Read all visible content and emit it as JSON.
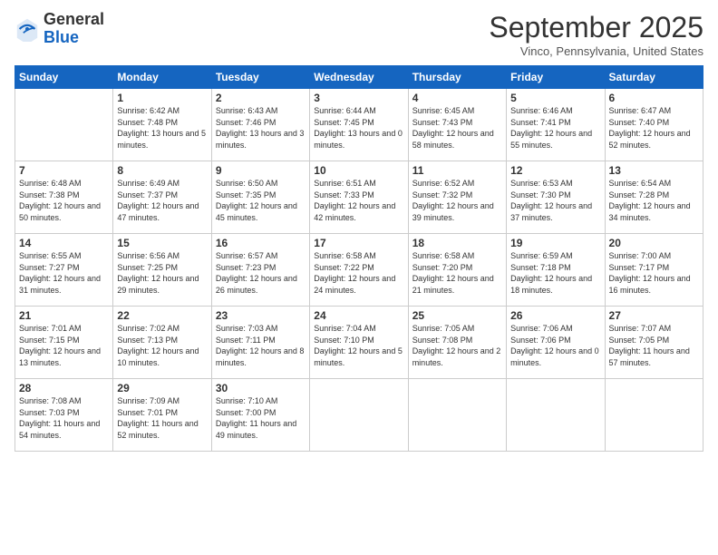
{
  "header": {
    "logo_general": "General",
    "logo_blue": "Blue",
    "month_title": "September 2025",
    "location": "Vinco, Pennsylvania, United States"
  },
  "days_of_week": [
    "Sunday",
    "Monday",
    "Tuesday",
    "Wednesday",
    "Thursday",
    "Friday",
    "Saturday"
  ],
  "weeks": [
    [
      {
        "num": "",
        "sunrise": "",
        "sunset": "",
        "daylight": ""
      },
      {
        "num": "1",
        "sunrise": "Sunrise: 6:42 AM",
        "sunset": "Sunset: 7:48 PM",
        "daylight": "Daylight: 13 hours and 5 minutes."
      },
      {
        "num": "2",
        "sunrise": "Sunrise: 6:43 AM",
        "sunset": "Sunset: 7:46 PM",
        "daylight": "Daylight: 13 hours and 3 minutes."
      },
      {
        "num": "3",
        "sunrise": "Sunrise: 6:44 AM",
        "sunset": "Sunset: 7:45 PM",
        "daylight": "Daylight: 13 hours and 0 minutes."
      },
      {
        "num": "4",
        "sunrise": "Sunrise: 6:45 AM",
        "sunset": "Sunset: 7:43 PM",
        "daylight": "Daylight: 12 hours and 58 minutes."
      },
      {
        "num": "5",
        "sunrise": "Sunrise: 6:46 AM",
        "sunset": "Sunset: 7:41 PM",
        "daylight": "Daylight: 12 hours and 55 minutes."
      },
      {
        "num": "6",
        "sunrise": "Sunrise: 6:47 AM",
        "sunset": "Sunset: 7:40 PM",
        "daylight": "Daylight: 12 hours and 52 minutes."
      }
    ],
    [
      {
        "num": "7",
        "sunrise": "Sunrise: 6:48 AM",
        "sunset": "Sunset: 7:38 PM",
        "daylight": "Daylight: 12 hours and 50 minutes."
      },
      {
        "num": "8",
        "sunrise": "Sunrise: 6:49 AM",
        "sunset": "Sunset: 7:37 PM",
        "daylight": "Daylight: 12 hours and 47 minutes."
      },
      {
        "num": "9",
        "sunrise": "Sunrise: 6:50 AM",
        "sunset": "Sunset: 7:35 PM",
        "daylight": "Daylight: 12 hours and 45 minutes."
      },
      {
        "num": "10",
        "sunrise": "Sunrise: 6:51 AM",
        "sunset": "Sunset: 7:33 PM",
        "daylight": "Daylight: 12 hours and 42 minutes."
      },
      {
        "num": "11",
        "sunrise": "Sunrise: 6:52 AM",
        "sunset": "Sunset: 7:32 PM",
        "daylight": "Daylight: 12 hours and 39 minutes."
      },
      {
        "num": "12",
        "sunrise": "Sunrise: 6:53 AM",
        "sunset": "Sunset: 7:30 PM",
        "daylight": "Daylight: 12 hours and 37 minutes."
      },
      {
        "num": "13",
        "sunrise": "Sunrise: 6:54 AM",
        "sunset": "Sunset: 7:28 PM",
        "daylight": "Daylight: 12 hours and 34 minutes."
      }
    ],
    [
      {
        "num": "14",
        "sunrise": "Sunrise: 6:55 AM",
        "sunset": "Sunset: 7:27 PM",
        "daylight": "Daylight: 12 hours and 31 minutes."
      },
      {
        "num": "15",
        "sunrise": "Sunrise: 6:56 AM",
        "sunset": "Sunset: 7:25 PM",
        "daylight": "Daylight: 12 hours and 29 minutes."
      },
      {
        "num": "16",
        "sunrise": "Sunrise: 6:57 AM",
        "sunset": "Sunset: 7:23 PM",
        "daylight": "Daylight: 12 hours and 26 minutes."
      },
      {
        "num": "17",
        "sunrise": "Sunrise: 6:58 AM",
        "sunset": "Sunset: 7:22 PM",
        "daylight": "Daylight: 12 hours and 24 minutes."
      },
      {
        "num": "18",
        "sunrise": "Sunrise: 6:58 AM",
        "sunset": "Sunset: 7:20 PM",
        "daylight": "Daylight: 12 hours and 21 minutes."
      },
      {
        "num": "19",
        "sunrise": "Sunrise: 6:59 AM",
        "sunset": "Sunset: 7:18 PM",
        "daylight": "Daylight: 12 hours and 18 minutes."
      },
      {
        "num": "20",
        "sunrise": "Sunrise: 7:00 AM",
        "sunset": "Sunset: 7:17 PM",
        "daylight": "Daylight: 12 hours and 16 minutes."
      }
    ],
    [
      {
        "num": "21",
        "sunrise": "Sunrise: 7:01 AM",
        "sunset": "Sunset: 7:15 PM",
        "daylight": "Daylight: 12 hours and 13 minutes."
      },
      {
        "num": "22",
        "sunrise": "Sunrise: 7:02 AM",
        "sunset": "Sunset: 7:13 PM",
        "daylight": "Daylight: 12 hours and 10 minutes."
      },
      {
        "num": "23",
        "sunrise": "Sunrise: 7:03 AM",
        "sunset": "Sunset: 7:11 PM",
        "daylight": "Daylight: 12 hours and 8 minutes."
      },
      {
        "num": "24",
        "sunrise": "Sunrise: 7:04 AM",
        "sunset": "Sunset: 7:10 PM",
        "daylight": "Daylight: 12 hours and 5 minutes."
      },
      {
        "num": "25",
        "sunrise": "Sunrise: 7:05 AM",
        "sunset": "Sunset: 7:08 PM",
        "daylight": "Daylight: 12 hours and 2 minutes."
      },
      {
        "num": "26",
        "sunrise": "Sunrise: 7:06 AM",
        "sunset": "Sunset: 7:06 PM",
        "daylight": "Daylight: 12 hours and 0 minutes."
      },
      {
        "num": "27",
        "sunrise": "Sunrise: 7:07 AM",
        "sunset": "Sunset: 7:05 PM",
        "daylight": "Daylight: 11 hours and 57 minutes."
      }
    ],
    [
      {
        "num": "28",
        "sunrise": "Sunrise: 7:08 AM",
        "sunset": "Sunset: 7:03 PM",
        "daylight": "Daylight: 11 hours and 54 minutes."
      },
      {
        "num": "29",
        "sunrise": "Sunrise: 7:09 AM",
        "sunset": "Sunset: 7:01 PM",
        "daylight": "Daylight: 11 hours and 52 minutes."
      },
      {
        "num": "30",
        "sunrise": "Sunrise: 7:10 AM",
        "sunset": "Sunset: 7:00 PM",
        "daylight": "Daylight: 11 hours and 49 minutes."
      },
      {
        "num": "",
        "sunrise": "",
        "sunset": "",
        "daylight": ""
      },
      {
        "num": "",
        "sunrise": "",
        "sunset": "",
        "daylight": ""
      },
      {
        "num": "",
        "sunrise": "",
        "sunset": "",
        "daylight": ""
      },
      {
        "num": "",
        "sunrise": "",
        "sunset": "",
        "daylight": ""
      }
    ]
  ]
}
